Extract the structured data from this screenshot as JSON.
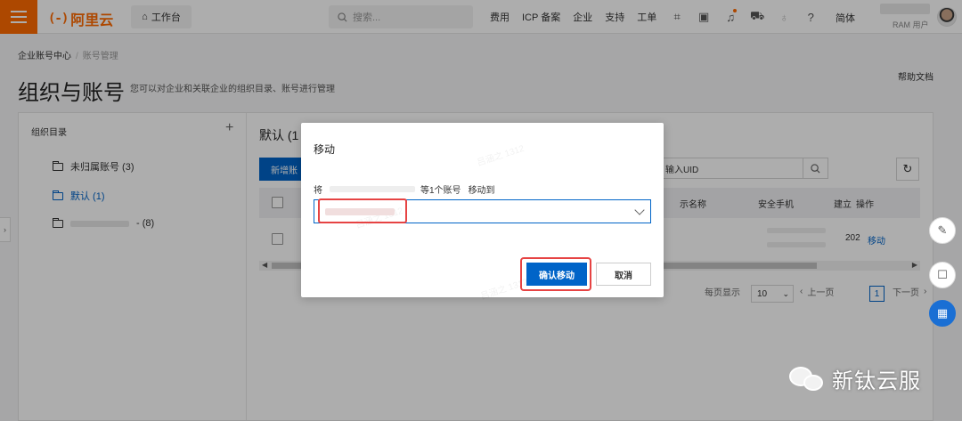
{
  "topbar": {
    "logo_mark": "(-)",
    "logo_text": "阿里云",
    "workbench": "工作台",
    "search_placeholder": "搜索...",
    "nav_items": [
      "费用",
      "ICP 备案",
      "企业",
      "支持",
      "工单"
    ],
    "lang": "简体",
    "user_role": "RAM 用户"
  },
  "breadcrumb": {
    "root": "企业账号中心",
    "sep": "/",
    "current": "账号管理"
  },
  "page": {
    "title": "组织与账号",
    "subtitle": "您可以对企业和关联企业的组织目录、账号进行管理",
    "help": "帮助文档"
  },
  "tree": {
    "title": "组织目录",
    "add": "+",
    "items": [
      {
        "label": "未归属账号 (3)"
      },
      {
        "label": "默认 (1)"
      },
      {
        "label": "- (8)"
      }
    ]
  },
  "main": {
    "heading": "默认 (1",
    "new_button": "新增账",
    "uid_placeholder": "输入UID",
    "columns": [
      "示名称",
      "安全手机",
      "建立",
      "操作"
    ],
    "row": {
      "created": "202",
      "action": "移动"
    }
  },
  "pager": {
    "page_size_label": "每页显示",
    "page_size": "10",
    "prev": "上一页",
    "current_page": "1",
    "next": "下一页"
  },
  "modal": {
    "title": "移动",
    "prefix": "将",
    "count_text": "等1个账号",
    "move_to": "移动到",
    "confirm": "确认移动",
    "cancel": "取消",
    "watermark": "吕涵之 1312"
  },
  "brand": {
    "text": "新钛云服"
  },
  "colors": {
    "accent": "#ff6a00",
    "primary": "#0064c8",
    "highlight": "#e64343"
  }
}
